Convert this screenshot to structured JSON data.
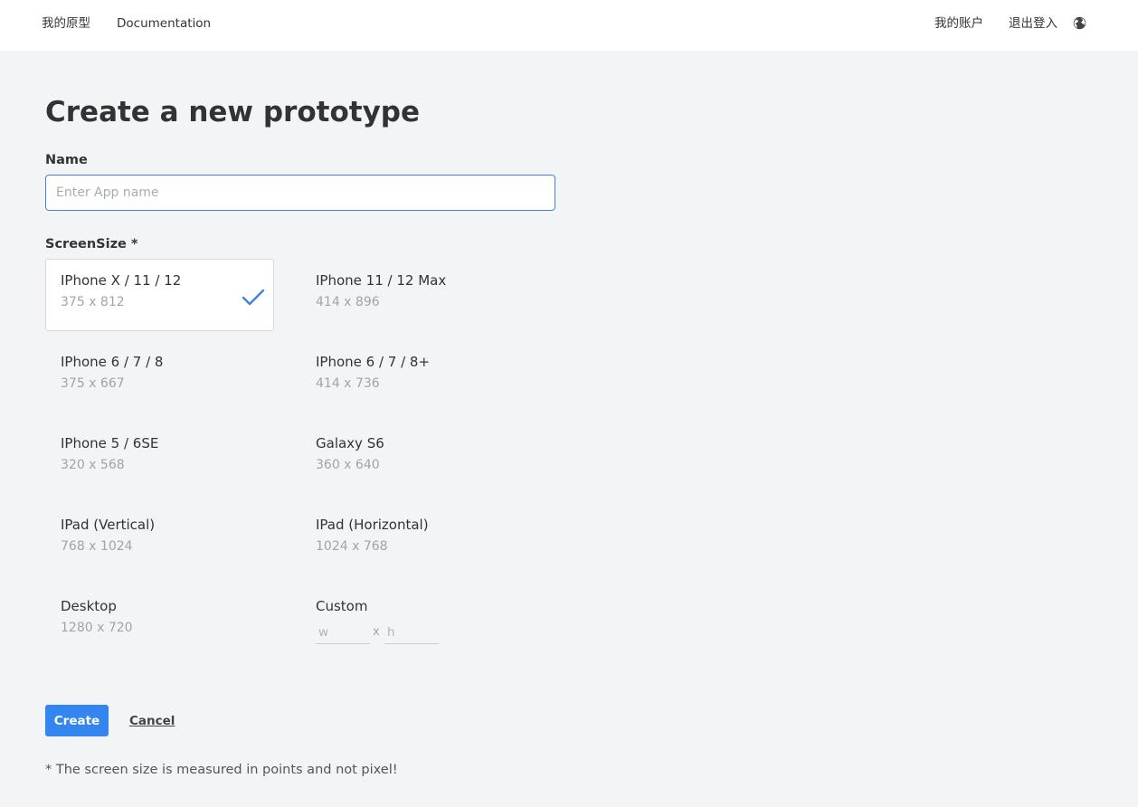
{
  "nav": {
    "my_prototypes": "我的原型",
    "documentation": "Documentation",
    "my_account": "我的账户",
    "logout": "退出登入",
    "language_icon": "globe-icon"
  },
  "page": {
    "title": "Create a new prototype"
  },
  "form": {
    "name_label": "Name",
    "name_placeholder": "Enter App name",
    "name_value": "",
    "screensize_label": "ScreenSize *",
    "sizes": [
      {
        "name": "IPhone X / 11 / 12",
        "dims": "375 x 812",
        "selected": true
      },
      {
        "name": "IPhone 11 / 12 Max",
        "dims": "414 x 896",
        "selected": false
      },
      {
        "name": "IPhone 6 / 7 / 8",
        "dims": "375 x 667",
        "selected": false
      },
      {
        "name": "IPhone 6 / 7 / 8+",
        "dims": "414 x 736",
        "selected": false
      },
      {
        "name": "IPhone 5 / 6SE",
        "dims": "320 x 568",
        "selected": false
      },
      {
        "name": "Galaxy S6",
        "dims": "360 x 640",
        "selected": false
      },
      {
        "name": "IPad (Vertical)",
        "dims": "768 x 1024",
        "selected": false
      },
      {
        "name": "IPad (Horizontal)",
        "dims": "1024 x 768",
        "selected": false
      },
      {
        "name": "Desktop",
        "dims": "1280 x 720",
        "selected": false
      }
    ],
    "custom": {
      "name": "Custom",
      "width_placeholder": "w",
      "height_placeholder": "h",
      "separator": "x"
    },
    "create_label": "Create",
    "cancel_label": "Cancel",
    "footnote": "* The screen size is measured in points and not pixel!"
  },
  "colors": {
    "accent": "#3385f0",
    "background": "#f3f4f6",
    "checkmark": "#3f82e6"
  }
}
